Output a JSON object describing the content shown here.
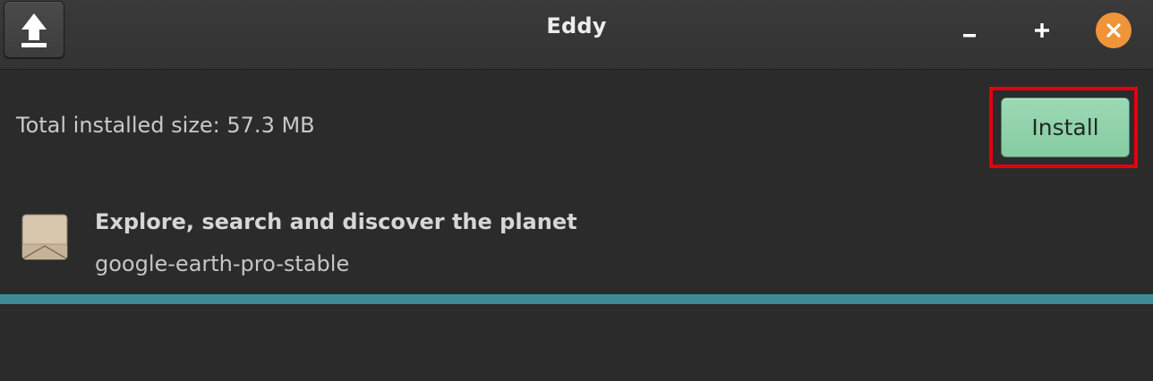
{
  "window": {
    "title": "Eddy"
  },
  "titlebar": {
    "upload_icon": "upload-arrow-icon",
    "minimize_icon": "minimize-icon",
    "maximize_icon": "plus-icon",
    "close_icon": "close-icon"
  },
  "summary": {
    "total_size_label": "Total installed size: 57.3 MB",
    "install_label": "Install"
  },
  "package": {
    "icon": "package-icon",
    "description": "Explore, search and discover the planet",
    "name": "google-earth-pro-stable"
  },
  "progress": {
    "fraction": 1.0
  },
  "colors": {
    "accent_install": "#8fd1aa",
    "close": "#f0943a",
    "progress": "#3d8c94",
    "highlight": "#e3000f"
  }
}
